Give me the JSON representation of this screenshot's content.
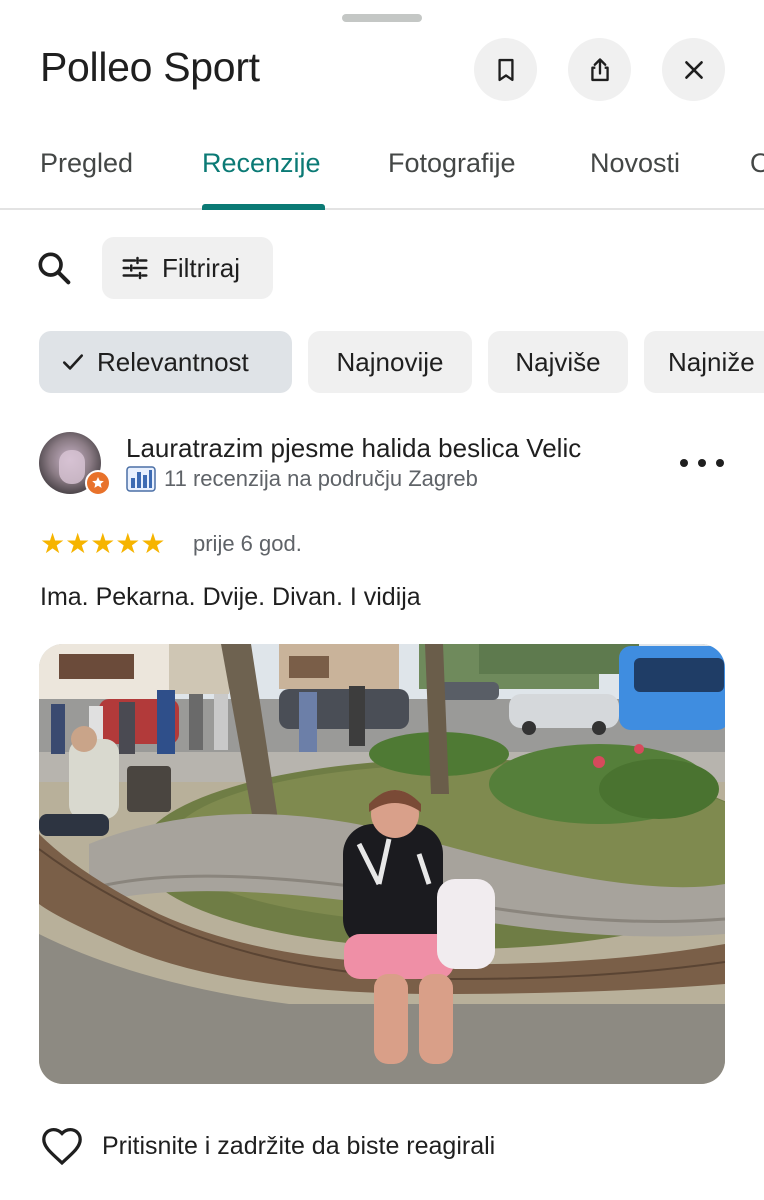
{
  "header": {
    "title": "Polleo Sport",
    "save_icon": "bookmark-icon",
    "share_icon": "share-icon",
    "close_icon": "close-icon"
  },
  "tabs": [
    {
      "label": "Pregled",
      "active": false
    },
    {
      "label": "Recenzije",
      "active": true
    },
    {
      "label": "Fotografije",
      "active": false
    },
    {
      "label": "Novosti",
      "active": false
    },
    {
      "label": "O",
      "active": false
    }
  ],
  "toolbar": {
    "search_icon": "search-icon",
    "filter_label": "Filtriraj"
  },
  "sort_chips": [
    {
      "label": "Relevantnost",
      "selected": true
    },
    {
      "label": "Najnovije",
      "selected": false
    },
    {
      "label": "Najviše",
      "selected": false
    },
    {
      "label": "Najniže",
      "selected": false
    }
  ],
  "review": {
    "author": "Lauratrazim pjesme halida beslica Velic",
    "author_meta": "11 recenzija na području Zagreb",
    "rating": 5,
    "stars_text": "★★★★★",
    "date": "prije 6 god.",
    "text": "Ima. Pekarna. Dvije. Divan. I vidija",
    "react_label": "Pritisnite i zadržite da biste reagirali"
  },
  "colors": {
    "accent": "#0b7a75",
    "star": "#f6b400",
    "chip_bg": "#f0f0f0",
    "chip_selected_bg": "#dfe3e7",
    "badge": "#e8722b",
    "bus": "#3f8de0"
  }
}
